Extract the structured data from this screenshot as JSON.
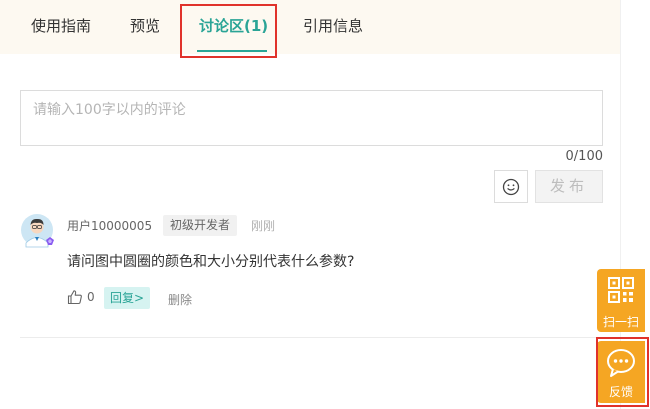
{
  "tabs": [
    {
      "label": "使用指南",
      "active": false
    },
    {
      "label": "预览",
      "active": false
    },
    {
      "label": "讨论区(1)",
      "active": true
    },
    {
      "label": "引用信息",
      "active": false
    }
  ],
  "comment_box": {
    "placeholder": "请输入100字以内的评论",
    "value": "",
    "char_count": "0/100"
  },
  "toolbar": {
    "emoji_icon": "smile-icon",
    "publish_label": "发布"
  },
  "comment": {
    "username": "用户10000005",
    "level": "初级开发者",
    "time": "刚刚",
    "text": "请问图中圆圈的颜色和大小分别代表什么参数?",
    "like_count": "0",
    "reply_label": "回复>",
    "delete_label": "删除"
  },
  "floating": {
    "scan_label": "扫一扫",
    "feedback_label": "反馈"
  },
  "colors": {
    "accent": "#2aa496",
    "highlight": "#e0322b",
    "float": "#f5a623",
    "tabbar_bg": "#fdf9f1"
  }
}
